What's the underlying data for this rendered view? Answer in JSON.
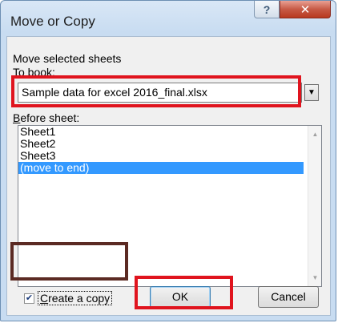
{
  "window": {
    "title": "Move or Copy",
    "help_glyph": "?",
    "close_glyph": "✕"
  },
  "dialog": {
    "section_label": "Move selected sheets",
    "to_book_label_prefix": "T",
    "to_book_label_rest": "o book:",
    "to_book_value": "Sample data for excel 2016_final.xlsx",
    "before_sheet_label_prefix": "B",
    "before_sheet_label_rest": "efore sheet:",
    "sheets": [
      "Sheet1",
      "Sheet2",
      "Sheet3",
      "(move to end)"
    ],
    "selected_sheet": "(move to end)",
    "create_copy_prefix": "C",
    "create_copy_rest": "reate a copy",
    "create_copy_checked": true,
    "check_glyph": "✔",
    "ok_label": "OK",
    "cancel_label": "Cancel"
  },
  "colors": {
    "highlight_red": "#e0141e",
    "highlight_dark": "#5b2a23",
    "selection": "#3399ff"
  }
}
